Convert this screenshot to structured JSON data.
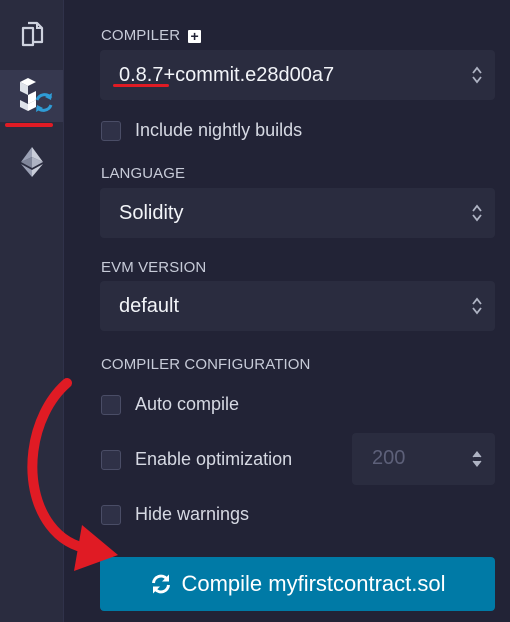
{
  "sidebar": {
    "items": [
      {
        "name": "file-explorer",
        "icon": "files-icon"
      },
      {
        "name": "solidity-compiler",
        "icon": "solidity-compiler-icon",
        "active": true
      },
      {
        "name": "deploy-run",
        "icon": "ethereum-icon"
      }
    ]
  },
  "compiler": {
    "label": "COMPILER",
    "add_icon": "plus-box-icon",
    "version": "0.8.7+commit.e28d00a7",
    "nightly_label": "Include nightly builds",
    "nightly_checked": false
  },
  "language": {
    "label": "LANGUAGE",
    "value": "Solidity"
  },
  "evm": {
    "label": "EVM VERSION",
    "value": "default"
  },
  "config": {
    "label": "COMPILER CONFIGURATION",
    "auto_compile_label": "Auto compile",
    "auto_compile_checked": false,
    "optimization_label": "Enable optimization",
    "optimization_checked": false,
    "runs_value": "200",
    "hide_warnings_label": "Hide warnings",
    "hide_warnings_checked": false
  },
  "compile_button": {
    "label": "Compile myfirstcontract.sol",
    "icon": "refresh-icon"
  },
  "annotations": {
    "highlight_color": "#e01b24",
    "accent_color": "#007aa6"
  }
}
